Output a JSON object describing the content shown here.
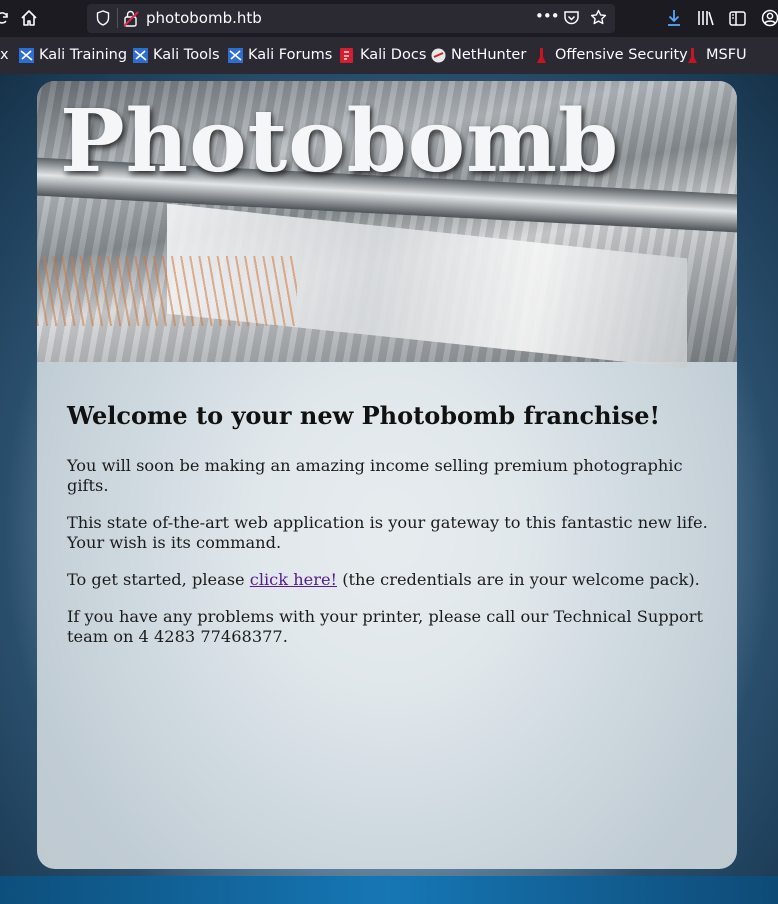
{
  "browser": {
    "url": "photobomb.htb",
    "bookmarks": [
      {
        "label": "Kali Training",
        "icon": "kali-icon"
      },
      {
        "label": "Kali Tools",
        "icon": "kali-icon"
      },
      {
        "label": "Kali Forums",
        "icon": "kali-icon"
      },
      {
        "label": "Kali Docs",
        "icon": "kali-docs-icon"
      },
      {
        "label": "NetHunter",
        "icon": "nethunter-icon"
      },
      {
        "label": "Offensive Security",
        "icon": "offsec-icon"
      },
      {
        "label": "MSFU",
        "icon": "offsec-icon"
      }
    ],
    "left_fragment": "x",
    "more_label": "•••"
  },
  "page": {
    "hero_title": "Photobomb",
    "heading": "Welcome to your new Photobomb franchise!",
    "para1": "You will soon be making an amazing income selling premium photographic gifts.",
    "para2": "This state of-the-art web application is your gateway to this fantastic new life. Your wish is its command.",
    "para3_before": "To get started, please ",
    "para3_link": "click here!",
    "para3_after": " (the credentials are in your welcome pack).",
    "para4": "If you have any problems with your printer, please call our Technical Support team on 4 4283 77468377."
  },
  "colors": {
    "toolbar_bg": "#1c1b22",
    "urlbar_bg": "#2b2a33",
    "link_visited": "#551a8b",
    "download_accent": "#54a8ff"
  }
}
